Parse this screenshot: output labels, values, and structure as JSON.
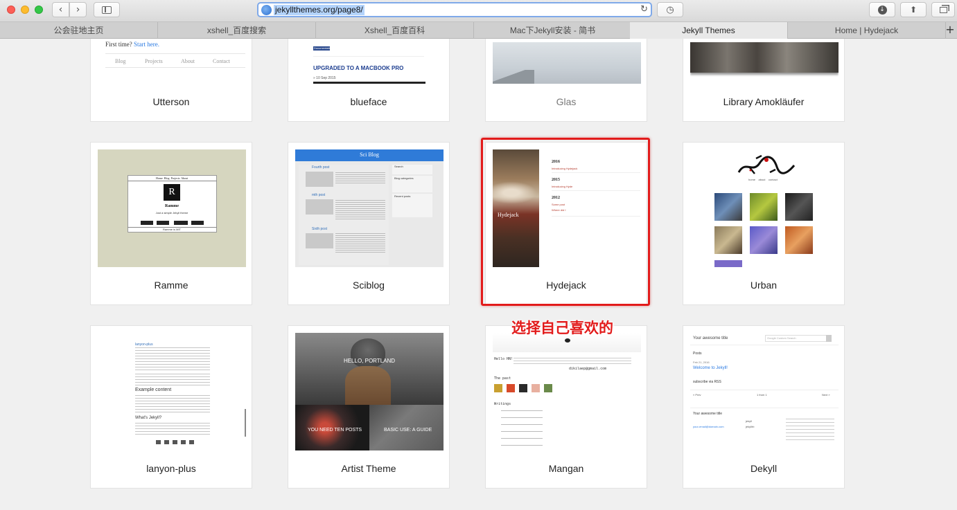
{
  "window": {
    "url": "jekyllthemes.org/page8/"
  },
  "tabs": [
    {
      "label": "公会驻地主页",
      "active": false
    },
    {
      "label": "xshell_百度搜索",
      "active": false
    },
    {
      "label": "Xshell_百度百科",
      "active": false
    },
    {
      "label": "Mac下Jekyll安装 - 简书",
      "active": false
    },
    {
      "label": "Jekyll Themes",
      "active": true
    },
    {
      "label": "Home | Hydejack",
      "active": false
    }
  ],
  "themes": [
    {
      "name": "Utterson"
    },
    {
      "name": "blueface"
    },
    {
      "name": "Glas"
    },
    {
      "name": "Library Amokläufer"
    },
    {
      "name": "Ramme"
    },
    {
      "name": "Sciblog"
    },
    {
      "name": "Hydejack"
    },
    {
      "name": "Urban"
    },
    {
      "name": "lanyon-plus"
    },
    {
      "name": "Artist Theme"
    },
    {
      "name": "Mangan"
    },
    {
      "name": "Dekyll"
    }
  ],
  "thumbs": {
    "utterson": {
      "first_time": "First time?",
      "start_here": "Start here.",
      "nav": [
        "Blog",
        "Projects",
        "About",
        "Contact"
      ]
    },
    "blueface": {
      "badge": "Documentation",
      "headline": "UPGRADED TO A MACBOOK PRO",
      "date": "» 10 Sep 2015"
    },
    "ramme": {
      "logo": "R",
      "title": "Ramme",
      "subtitle": "Just a simple Jekyll theme",
      "nav": [
        "Home",
        "Blog",
        "Projects",
        "About"
      ],
      "footer": "Ramme is MIT"
    },
    "sciblog": {
      "title": "Sci Blog",
      "posts": [
        "Fourth post",
        "mth post",
        "Sixth post"
      ],
      "widgets": [
        "Search",
        "Blog categories",
        "Recent posts"
      ]
    },
    "hydejack": {
      "label": "Hydejack",
      "years": [
        "2016",
        "2015",
        "2012"
      ],
      "links": [
        "Introducing Hydejack",
        "Introducing Hyde",
        "Some post",
        "Where did I"
      ]
    },
    "urban": {
      "nav": [
        "home",
        "about",
        "contact"
      ]
    },
    "lanyon": {
      "title": "lanyon-plus",
      "h1": "Example content",
      "h2": "What's Jekyll?"
    },
    "artist": {
      "hero": "HELLO, PORTLAND",
      "post1": "YOU NEED TEN POSTS",
      "post2": "BASIC USE: A GUIDE"
    },
    "mangan": {
      "hello": "Hello HN!",
      "posts_label": "The past",
      "writings": "Writings",
      "email": "dikilaep@gmail.com"
    },
    "dekyll": {
      "site": "Your awesome title",
      "search": "Google Custom Search",
      "posts": "Posts",
      "date": "Feb 21, 2016",
      "post": "Welcome to Jekyll!",
      "subscribe": "subscribe via RSS",
      "prev": "« Prev",
      "page": "1 from 1",
      "next": "Next »",
      "footer_title": "Your awesome title",
      "email": "your-email@domain.com",
      "gh": "jekyll",
      "tw": "jekyllrb"
    }
  },
  "annotation": {
    "text": "选择自己喜欢的"
  }
}
